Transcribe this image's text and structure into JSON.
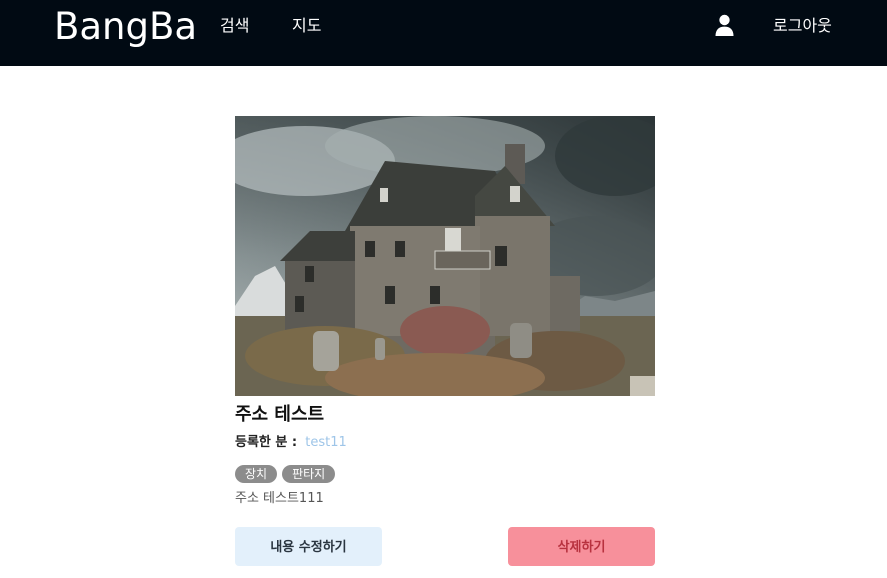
{
  "navbar": {
    "brand": "BangBa",
    "links": [
      "검색",
      "지도"
    ],
    "user_icon": "user-icon",
    "logout_label": "로그아웃",
    "background": "#010a13"
  },
  "listing": {
    "image_alt": "house-photo",
    "title": "주소 테스트",
    "registrant_label": "등록한 분 :",
    "registrant_name": "test11",
    "tags": [
      "장치",
      "판타지"
    ],
    "detail": "주소 테스트111",
    "edit_button": "내용 수정하기",
    "delete_button": "삭제하기"
  },
  "colors": {
    "tag_bg": "#8c8c8c",
    "edit_bg": "#e3f0fb",
    "delete_bg": "#f7909b",
    "delete_text": "#b8323f",
    "registrant_name": "#9ec5e8"
  }
}
